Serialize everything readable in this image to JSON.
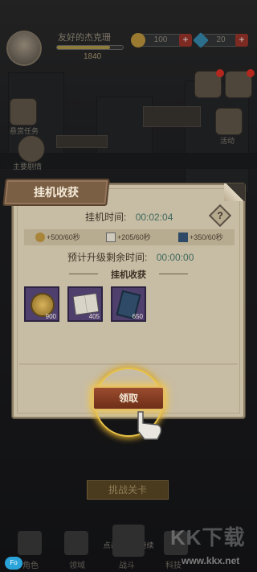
{
  "player": {
    "name": "友好的杰克珊",
    "power": "1840",
    "xp_fraction": 0.8
  },
  "resources": {
    "coins": "100",
    "gems": "20"
  },
  "side_labels": {
    "left_task": "悬赏任务",
    "left_extra": "主要剧情",
    "right_extra": "活动"
  },
  "panel": {
    "title": "挂机收获",
    "idle_time_label": "挂机时间:",
    "idle_time_value": "00:02:04",
    "help_symbol": "?",
    "rates": [
      "+500/60秒",
      "+205/60秒",
      "+350/60秒"
    ],
    "levelup_label": "预计升级剩余时间:",
    "levelup_value": "00:00:00",
    "rewards_title": "挂机收获",
    "rewards": [
      {
        "icon": "gold-coin-icon",
        "count": "900"
      },
      {
        "icon": "open-book-icon",
        "count": "405"
      },
      {
        "icon": "blue-manual-icon",
        "count": "650"
      }
    ],
    "claim_label": "领取"
  },
  "bottom": {
    "challenge_label": "挑战关卡",
    "tip": "点击空白处继续",
    "nav": [
      "角色",
      "领域",
      "战斗",
      "科技"
    ]
  },
  "watermark": {
    "text": "KK下载",
    "url": "www.kkx.net"
  },
  "colors": {
    "panel_bg": "#c7bca4",
    "ribbon": "#7b5f45",
    "time_value": "#3e6a5e",
    "claim_button": "#9b4c2e",
    "glow": "#f0c95b"
  }
}
